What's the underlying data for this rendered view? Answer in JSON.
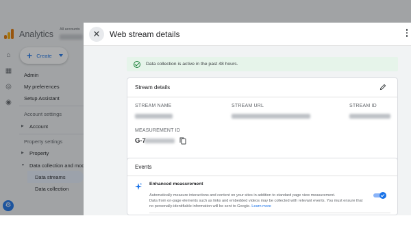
{
  "app": {
    "title": "Analytics",
    "account_label": "All accounts"
  },
  "sidebar": {
    "create_label": "Create",
    "items": [
      {
        "label": "Admin"
      },
      {
        "label": "My preferences"
      },
      {
        "label": "Setup Assistant"
      }
    ],
    "account_settings_header": "Account settings",
    "account_label": "Account",
    "property_settings_header": "Property settings",
    "property_label": "Property",
    "data_collection_group": "Data collection and modi",
    "sub_items": [
      {
        "label": "Data streams",
        "active": true
      },
      {
        "label": "Data collection",
        "active": false
      }
    ]
  },
  "drawer": {
    "title": "Web stream details",
    "banner": "Data collection is active in the past 48 hours.",
    "stream_details": {
      "title": "Stream details",
      "name_label": "STREAM NAME",
      "url_label": "STREAM URL",
      "id_label": "STREAM ID",
      "measurement_id_label": "MEASUREMENT ID",
      "measurement_id_prefix": "G-7"
    },
    "events": {
      "title": "Events",
      "enhanced_title": "Enhanced measurement",
      "enhanced_desc_1": "Automatically measure interactions and content on your sites in addition to standard page view measurement.",
      "enhanced_desc_2": "Data from on-page elements such as links and embedded videos may be collected with relevant events. You must ensure that no personally-identifiable information will be sent to Google.",
      "learn_more": "Learn more",
      "enabled": true
    }
  },
  "colors": {
    "accent": "#1a73e8",
    "success": "#188038",
    "banner_bg": "#e6f4ea"
  }
}
